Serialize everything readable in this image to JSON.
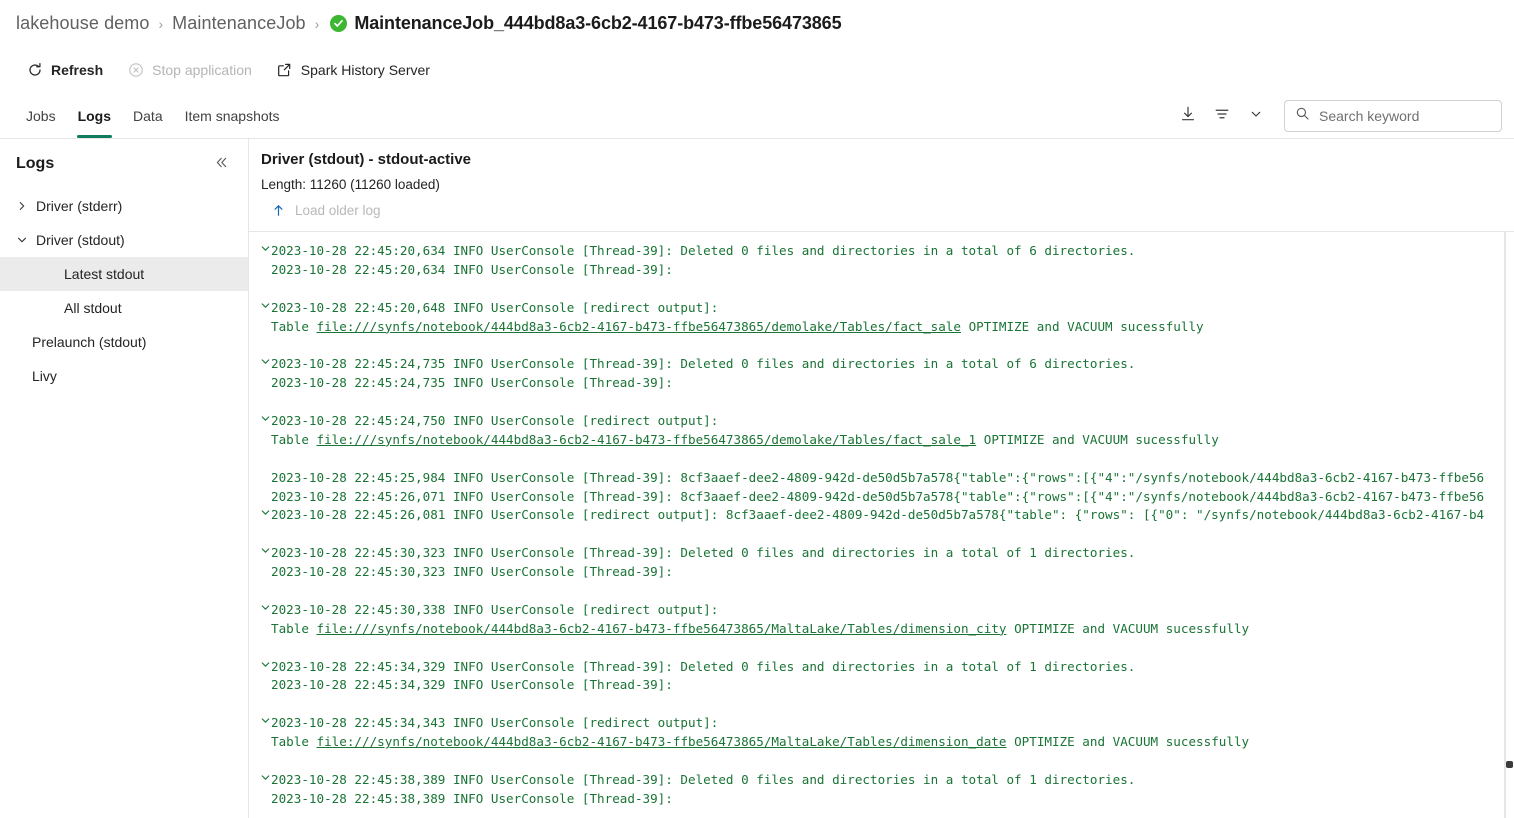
{
  "breadcrumb": {
    "items": [
      {
        "label": "lakehouse demo"
      },
      {
        "label": "MaintenanceJob"
      }
    ],
    "separator": "›",
    "current": "MaintenanceJob_444bd8a3-6cb2-4167-b473-ffbe56473865",
    "status_icon": "success-check-icon",
    "status_color": "#3db631"
  },
  "commands": {
    "refresh": "Refresh",
    "stop_application": "Stop application",
    "spark_history_server": "Spark History Server"
  },
  "tabs": [
    {
      "label": "Jobs",
      "active": false
    },
    {
      "label": "Logs",
      "active": true
    },
    {
      "label": "Data",
      "active": false
    },
    {
      "label": "Item snapshots",
      "active": false
    }
  ],
  "toolbar": {
    "download_icon": "download-icon",
    "filter_icon": "filter-icon",
    "chevron_icon": "chevron-down-icon",
    "accent_color": "#107c5d"
  },
  "search": {
    "placeholder": "Search keyword",
    "value": "",
    "icon": "search-icon"
  },
  "sidebar": {
    "title": "Logs",
    "collapse_icon": "chevron-double-left-icon",
    "items": [
      {
        "label": "Driver (stderr)",
        "level": 1,
        "expandable": true,
        "expanded": false,
        "selected": false
      },
      {
        "label": "Driver (stdout)",
        "level": 1,
        "expandable": true,
        "expanded": true,
        "selected": false
      },
      {
        "label": "Latest stdout",
        "level": 2,
        "expandable": false,
        "expanded": false,
        "selected": true
      },
      {
        "label": "All stdout",
        "level": 2,
        "expandable": false,
        "expanded": false,
        "selected": false
      },
      {
        "label": "Prelaunch (stdout)",
        "level": 1,
        "expandable": false,
        "expanded": false,
        "selected": false
      },
      {
        "label": "Livy",
        "level": 1,
        "expandable": false,
        "expanded": false,
        "selected": false
      }
    ]
  },
  "log_pane": {
    "title": "Driver (stdout) - stdout-active",
    "length_label": "Length: 11260 (11260 loaded)",
    "load_older_label": "Load older log",
    "load_older_icon": "arrow-up-icon",
    "text_color": "#1a7436",
    "lines": [
      {
        "chevron": "down",
        "text": "2023-10-28 22:45:20,634 INFO UserConsole [Thread-39]: Deleted 0 files and directories in a total of 6 directories."
      },
      {
        "chevron": "none",
        "text": "2023-10-28 22:45:20,634 INFO UserConsole [Thread-39]:"
      },
      {
        "chevron": "none",
        "text": ""
      },
      {
        "chevron": "down",
        "text": "2023-10-28 22:45:20,648 INFO UserConsole [redirect output]:"
      },
      {
        "chevron": "none",
        "pre": "Table ",
        "link": "file:///synfs/notebook/444bd8a3-6cb2-4167-b473-ffbe56473865/demolake/Tables/fact_sale",
        "post": " OPTIMIZE and VACUUM sucessfully"
      },
      {
        "chevron": "none",
        "text": ""
      },
      {
        "chevron": "down",
        "text": "2023-10-28 22:45:24,735 INFO UserConsole [Thread-39]: Deleted 0 files and directories in a total of 6 directories."
      },
      {
        "chevron": "none",
        "text": "2023-10-28 22:45:24,735 INFO UserConsole [Thread-39]:"
      },
      {
        "chevron": "none",
        "text": ""
      },
      {
        "chevron": "down",
        "text": "2023-10-28 22:45:24,750 INFO UserConsole [redirect output]:"
      },
      {
        "chevron": "none",
        "pre": "Table ",
        "link": "file:///synfs/notebook/444bd8a3-6cb2-4167-b473-ffbe56473865/demolake/Tables/fact_sale_1",
        "post": " OPTIMIZE and VACUUM sucessfully"
      },
      {
        "chevron": "none",
        "text": ""
      },
      {
        "chevron": "none",
        "text": "2023-10-28 22:45:25,984 INFO UserConsole [Thread-39]: 8cf3aaef-dee2-4809-942d-de50d5b7a578{\"table\":{\"rows\":[{\"4\":\"/synfs/notebook/444bd8a3-6cb2-4167-b473-ffbe56"
      },
      {
        "chevron": "none",
        "text": "2023-10-28 22:45:26,071 INFO UserConsole [Thread-39]: 8cf3aaef-dee2-4809-942d-de50d5b7a578{\"table\":{\"rows\":[{\"4\":\"/synfs/notebook/444bd8a3-6cb2-4167-b473-ffbe56"
      },
      {
        "chevron": "down",
        "text": "2023-10-28 22:45:26,081 INFO UserConsole [redirect output]: 8cf3aaef-dee2-4809-942d-de50d5b7a578{\"table\": {\"rows\": [{\"0\": \"/synfs/notebook/444bd8a3-6cb2-4167-b4"
      },
      {
        "chevron": "none",
        "text": ""
      },
      {
        "chevron": "down",
        "text": "2023-10-28 22:45:30,323 INFO UserConsole [Thread-39]: Deleted 0 files and directories in a total of 1 directories."
      },
      {
        "chevron": "none",
        "text": "2023-10-28 22:45:30,323 INFO UserConsole [Thread-39]:"
      },
      {
        "chevron": "none",
        "text": ""
      },
      {
        "chevron": "down",
        "text": "2023-10-28 22:45:30,338 INFO UserConsole [redirect output]:"
      },
      {
        "chevron": "none",
        "pre": "Table ",
        "link": "file:///synfs/notebook/444bd8a3-6cb2-4167-b473-ffbe56473865/MaltaLake/Tables/dimension_city",
        "post": " OPTIMIZE and VACUUM sucessfully"
      },
      {
        "chevron": "none",
        "text": ""
      },
      {
        "chevron": "down",
        "text": "2023-10-28 22:45:34,329 INFO UserConsole [Thread-39]: Deleted 0 files and directories in a total of 1 directories."
      },
      {
        "chevron": "none",
        "text": "2023-10-28 22:45:34,329 INFO UserConsole [Thread-39]:"
      },
      {
        "chevron": "none",
        "text": ""
      },
      {
        "chevron": "down",
        "text": "2023-10-28 22:45:34,343 INFO UserConsole [redirect output]:"
      },
      {
        "chevron": "none",
        "pre": "Table ",
        "link": "file:///synfs/notebook/444bd8a3-6cb2-4167-b473-ffbe56473865/MaltaLake/Tables/dimension_date",
        "post": " OPTIMIZE and VACUUM sucessfully"
      },
      {
        "chevron": "none",
        "text": ""
      },
      {
        "chevron": "down",
        "text": "2023-10-28 22:45:38,389 INFO UserConsole [Thread-39]: Deleted 0 files and directories in a total of 1 directories."
      },
      {
        "chevron": "none",
        "text": "2023-10-28 22:45:38,389 INFO UserConsole [Thread-39]:"
      }
    ]
  }
}
